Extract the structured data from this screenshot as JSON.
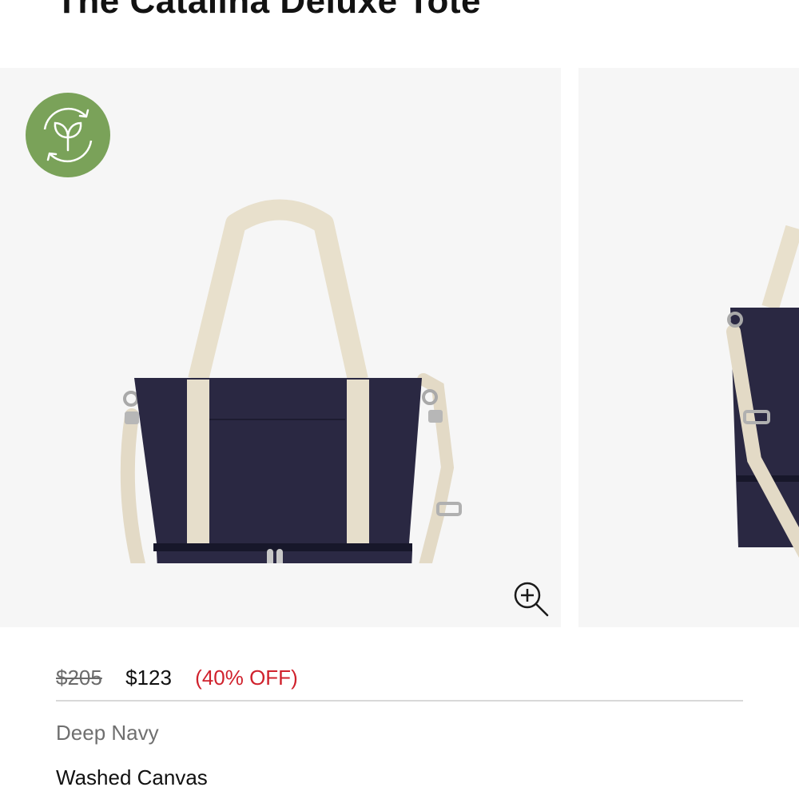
{
  "product": {
    "title": "The Catalina Deluxe Tote"
  },
  "gallery": {
    "badge_icon": "eco-leaf-recycle-icon",
    "zoom_icon": "zoom-in-icon",
    "colors": {
      "background": "#f6f6f6",
      "badge": "#7aa259",
      "bag_body": "#27253f",
      "strap": "#e8e0cc"
    }
  },
  "pricing": {
    "original": "$205",
    "sale": "$123",
    "discount": "(40% OFF)",
    "discount_color": "#d0222d"
  },
  "details": {
    "color": "Deep Navy",
    "material": "Washed Canvas"
  }
}
